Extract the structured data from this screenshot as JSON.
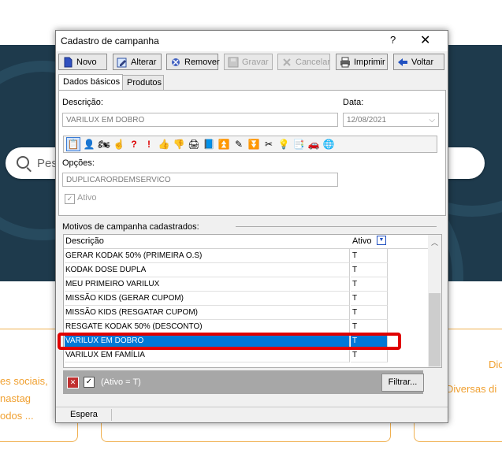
{
  "background": {
    "search_placeholder": "Pes",
    "card_left_lines": [
      "es sociais,",
      "nastag",
      "odos ..."
    ],
    "card_right_lines": [
      "Dic",
      "Diversas di"
    ]
  },
  "dialog": {
    "title": "Cadastro de  campanha",
    "help": "?",
    "close": "✕",
    "toolbar": {
      "novo": "Novo",
      "alterar": "Alterar",
      "remover": "Remover",
      "gravar": "Gravar",
      "cancelar": "Cancelar",
      "imprimir": "Imprimir",
      "voltar": "Voltar"
    },
    "tabs": [
      "Dados básicos",
      "Produtos"
    ],
    "form": {
      "descricao_label": "Descrição:",
      "descricao_value": "VARILUX EM DOBRO",
      "data_label": "Data:",
      "data_value": "12/08/2021",
      "opcoes_label": "Opções:",
      "opcoes_value": "DUPLICARORDEMSERVICO",
      "ativo_label": "Ativo"
    },
    "list": {
      "section_label": "Motivos de campanha cadastrados:",
      "col_descricao": "Descrição",
      "col_ativo": "Ativo",
      "rows": [
        {
          "descricao": "GERAR KODAK 50% (PRIMEIRA O.S)",
          "ativo": "T"
        },
        {
          "descricao": "KODAK DOSE DUPLA",
          "ativo": "T"
        },
        {
          "descricao": "MEU PRIMEIRO VARILUX",
          "ativo": "T"
        },
        {
          "descricao": "MISSÃO KIDS (GERAR CUPOM)",
          "ativo": "T"
        },
        {
          "descricao": "MISSÃO KIDS (RESGATAR CUPOM)",
          "ativo": "T"
        },
        {
          "descricao": "RESGATE KODAK 50% (DESCONTO)",
          "ativo": "T"
        },
        {
          "descricao": "VARILUX EM DOBRO",
          "ativo": "T"
        },
        {
          "descricao": "VARILUX EM FAMÍLIA",
          "ativo": "T"
        }
      ]
    },
    "filter": {
      "expression": "(Ativo = T)",
      "button": "Filtrar..."
    },
    "status": "Espera"
  },
  "colors": {
    "selection": "#0078d7",
    "highlight_box": "#e00000",
    "hero_bg": "#1e3a4c",
    "card_accent": "#f0a030"
  }
}
